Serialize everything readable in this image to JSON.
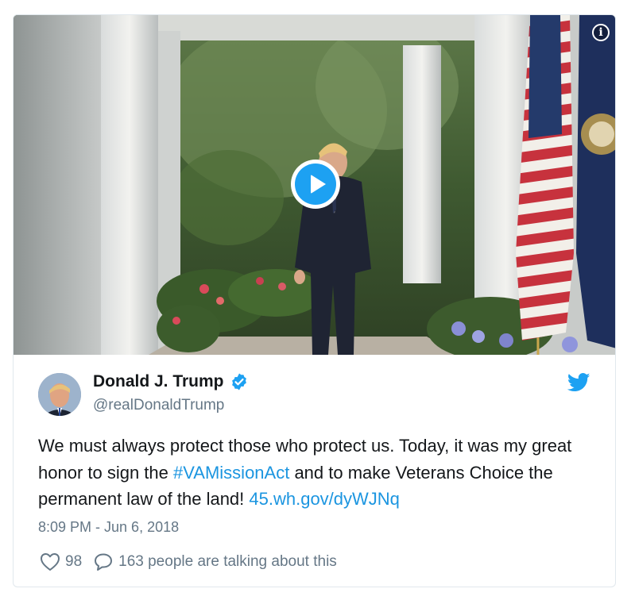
{
  "tweet": {
    "author_name": "Donald J. Trump",
    "author_handle": "@realDonaldTrump",
    "text_part1": "We must always protect those who protect us. Today, it was my great honor to sign the ",
    "hashtag": "#VAMissionAct",
    "text_part2": " and to make Veterans Choice the permanent law of the land! ",
    "link": "45.wh.gov/dyWJNq",
    "timestamp": "8:09 PM - Jun 6, 2018",
    "likes": "98",
    "conversation": "163 people are talking about this"
  },
  "media": {
    "info_label": "i"
  },
  "icons": {
    "verified": "verified-badge-icon",
    "bird": "twitter-bird-icon",
    "like": "heart-icon",
    "reply": "speech-bubble-icon",
    "play": "play-icon",
    "info": "info-icon"
  },
  "colors": {
    "twitter_blue": "#1da1f2",
    "link_blue": "#1b95e0",
    "text": "#14171a",
    "secondary": "#657786",
    "border": "#e1e8ed"
  }
}
